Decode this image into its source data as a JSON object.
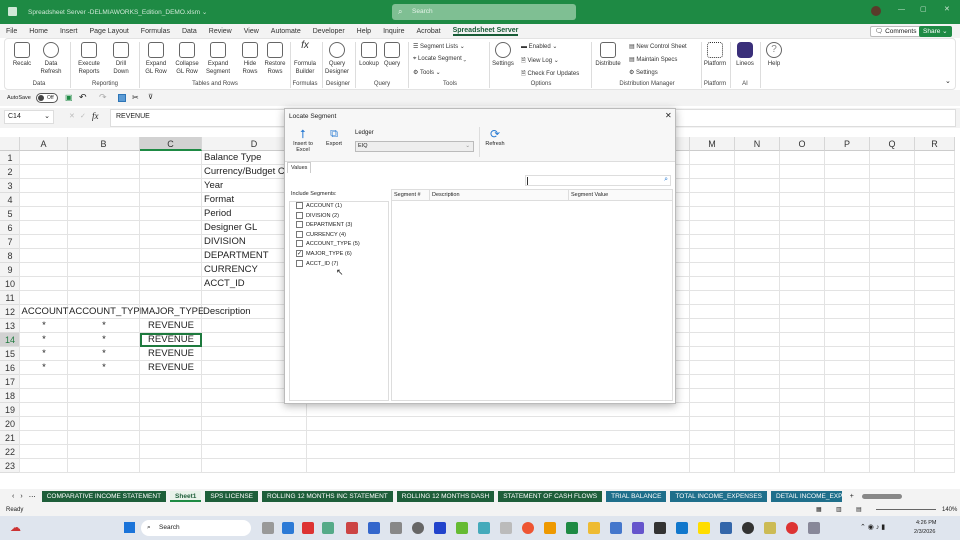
{
  "window": {
    "title": "Spreadsheet Server -DELMIAWORKS_Edition_DEMO.xlsm ⌄",
    "search_placeholder": "Search"
  },
  "menu": [
    "File",
    "Home",
    "Insert",
    "Page Layout",
    "Formulas",
    "Data",
    "Review",
    "View",
    "Automate",
    "Developer",
    "Help",
    "Inquire",
    "Acrobat",
    "Spreadsheet Server"
  ],
  "actions": {
    "comments": "Comments",
    "share": "Share"
  },
  "ribbon": {
    "groups": {
      "data": "Data",
      "reporting": "Reporting",
      "tables": "Tables and Rows",
      "formulas": "Formulas",
      "designer": "Designer",
      "query": "Query",
      "tools": "Tools",
      "options": "Options",
      "distribution": "Distribution Manager",
      "platform": "Platform",
      "ai": "AI"
    },
    "buttons": {
      "recalc": "Recalc",
      "data_refresh": "Data Refresh",
      "execute_reports": "Execute Reports",
      "drill_down": "Drill Down",
      "expand_gl": "Expand GL Row",
      "collapse_gl": "Collapse GL Row",
      "expand_segment": "Expand Segment",
      "hide_rows": "Hide Rows",
      "restore_rows": "Restore Rows",
      "formula_builder": "Formula Builder",
      "query_designer": "Query Designer",
      "lookup": "Lookup",
      "query": "Query",
      "segment_lists": "Segment Lists",
      "locate_segment": "Locate Segment",
      "tools": "Tools",
      "settings": "Settings",
      "enabled": "Enabled",
      "view_log": "View Log",
      "check_updates": "Check For Updates",
      "distribute": "Distribute",
      "new_control_sheet": "New Control Sheet",
      "maintain_specs": "Maintain Specs",
      "dm_settings": "Settings",
      "platform": "Platform",
      "lineos": "Lineos",
      "help": "Help"
    }
  },
  "qat": {
    "autosave": "AutoSave",
    "toggle": "Off"
  },
  "formula_bar": {
    "name_box": "C14",
    "fx": "fx",
    "value": "REVENUE"
  },
  "columns": [
    "A",
    "B",
    "C",
    "D",
    "M",
    "N",
    "O",
    "P",
    "Q",
    "R"
  ],
  "rows": [
    "1",
    "2",
    "3",
    "4",
    "5",
    "6",
    "7",
    "8",
    "9",
    "10",
    "11",
    "12",
    "13",
    "14",
    "15",
    "16",
    "17",
    "18",
    "19",
    "20",
    "21",
    "22",
    "23"
  ],
  "cells": {
    "D": [
      "Balance Type",
      "Currency/Budget C",
      "Year",
      "Format",
      "Period",
      "Designer GL",
      "DIVISION",
      "DEPARTMENT",
      "CURRENCY",
      "ACCT_ID"
    ],
    "row12": [
      "ACCOUNT",
      "ACCOUNT_TYPE",
      "MAJOR_TYPE",
      "Description"
    ],
    "data_rows": [
      [
        "*",
        "*",
        "REVENUE"
      ],
      [
        "*",
        "*",
        "REVENUE"
      ],
      [
        "*",
        "*",
        "REVENUE"
      ],
      [
        "*",
        "*",
        "REVENUE"
      ]
    ]
  },
  "dialog": {
    "title": "Locate Segment",
    "insert": "Insert to Excel",
    "export": "Export",
    "ledger_label": "Ledger",
    "ledger_value": "EIQ",
    "refresh": "Refresh",
    "tab": "Values",
    "include_label": "Include Segments:",
    "segments": [
      {
        "label": "ACCOUNT (1)",
        "checked": false
      },
      {
        "label": "DIVISION (2)",
        "checked": false
      },
      {
        "label": "DEPARTMENT (3)",
        "checked": false
      },
      {
        "label": "CURRENCY (4)",
        "checked": false
      },
      {
        "label": "ACCOUNT_TYPE (5)",
        "checked": false
      },
      {
        "label": "MAJOR_TYPE (6)",
        "checked": true
      },
      {
        "label": "ACCT_ID (7)",
        "checked": false
      }
    ],
    "grid_headers": [
      "Segment #",
      "Description",
      "Segment Value"
    ]
  },
  "sheet_tabs": [
    {
      "label": "COMPARATIVE INCOME STATEMENT",
      "style": "green"
    },
    {
      "label": "Sheet1",
      "style": "selected"
    },
    {
      "label": "SPS LICENSE",
      "style": "green"
    },
    {
      "label": "ROLLING 12 MONTHS INC STATEMENT",
      "style": "green"
    },
    {
      "label": "ROLLING 12 MONTHS DASH",
      "style": "green"
    },
    {
      "label": "STATEMENT OF CASH FLOWS",
      "style": "green"
    },
    {
      "label": "TRIAL BALANCE",
      "style": "blue"
    },
    {
      "label": "TOTAL INCOME_EXPENSES",
      "style": "blue"
    },
    {
      "label": "DETAIL INCOME_EXPE",
      "style": "blue"
    }
  ],
  "status": {
    "ready": "Ready",
    "zoom": "140%"
  },
  "taskbar": {
    "search": "Search",
    "time": "4:26 PM",
    "date": "2/3/2026"
  },
  "colors": {
    "excel_green": "#1e8a44",
    "tab_green": "#1e5e3a",
    "tab_blue": "#1f6f8b"
  }
}
